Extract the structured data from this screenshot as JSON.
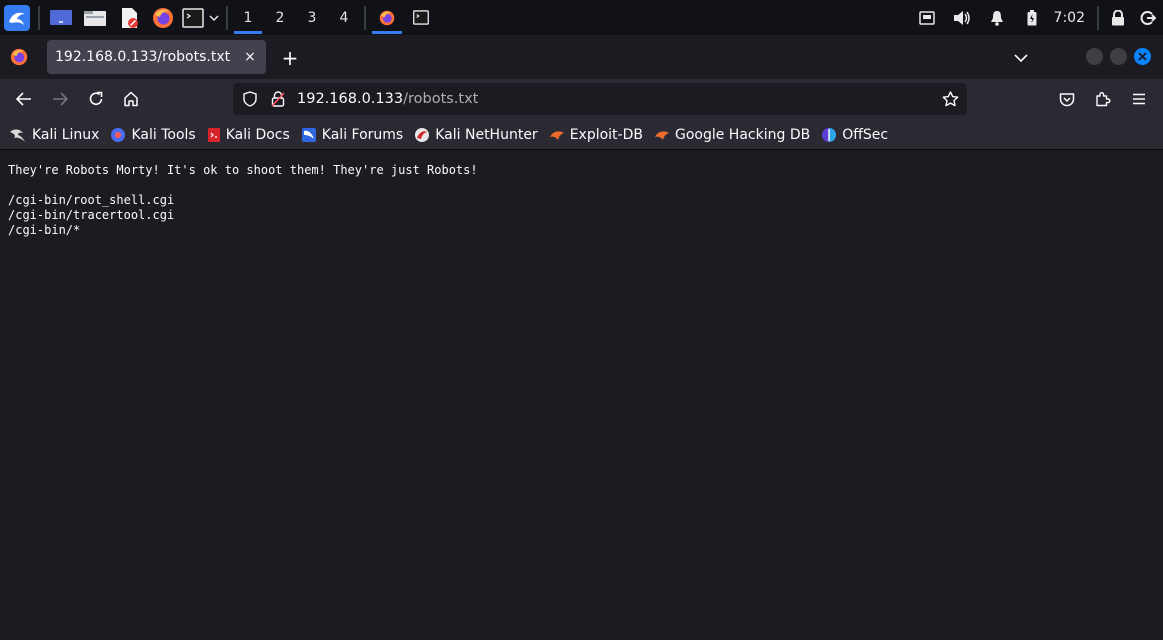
{
  "taskbar": {
    "workspaces": [
      "1",
      "2",
      "3",
      "4"
    ],
    "active_workspace": "1",
    "clock": "7:02"
  },
  "browser": {
    "tab": {
      "title": "192.168.0.133/robots.txt",
      "close": "×"
    },
    "new_tab": "+",
    "url": {
      "host": "192.168.0.133",
      "path": "/robots.txt"
    },
    "bookmarks": [
      {
        "label": "Kali Linux",
        "icon": "kali-dragon-icon"
      },
      {
        "label": "Kali Tools",
        "icon": "kali-tools-icon"
      },
      {
        "label": "Kali Docs",
        "icon": "kali-docs-icon"
      },
      {
        "label": "Kali Forums",
        "icon": "kali-forums-icon"
      },
      {
        "label": "Kali NetHunter",
        "icon": "nethunter-icon"
      },
      {
        "label": "Exploit-DB",
        "icon": "exploit-db-icon"
      },
      {
        "label": "Google Hacking DB",
        "icon": "ghdb-icon"
      },
      {
        "label": "OffSec",
        "icon": "offsec-icon"
      }
    ]
  },
  "page": {
    "lines": [
      "They're Robots Morty! It's ok to shoot them! They're just Robots!",
      "",
      "/cgi-bin/root_shell.cgi",
      "/cgi-bin/tracertool.cgi",
      "/cgi-bin/*"
    ]
  },
  "colors": {
    "accent": "#367bf0",
    "close_button": "#0a84ff"
  }
}
